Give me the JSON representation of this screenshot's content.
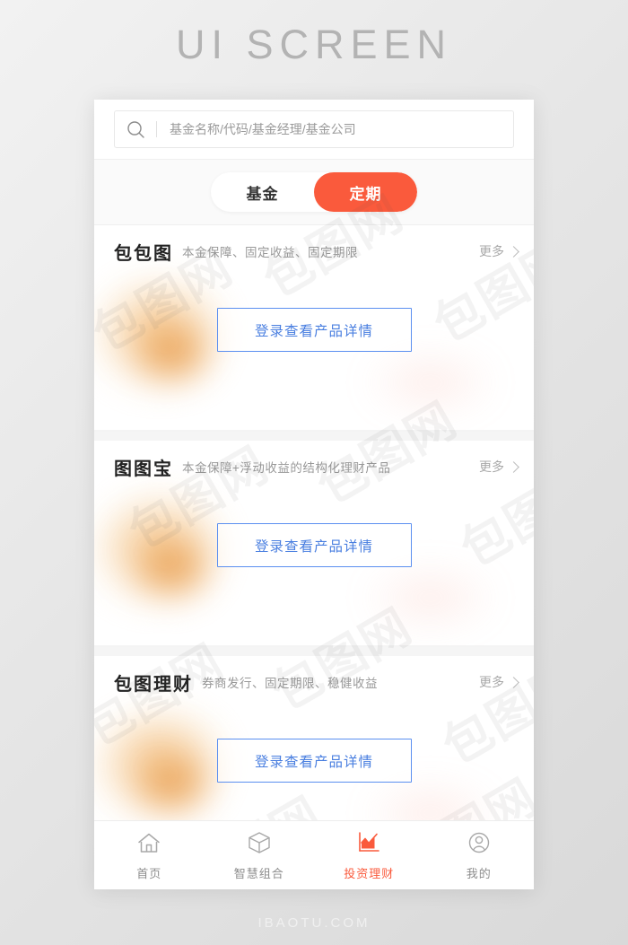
{
  "page": {
    "title": "UI SCREEN",
    "footer": "IBAOTU.COM",
    "watermark": "包图网"
  },
  "colors": {
    "accent": "#fa5a3c",
    "cta_blue": "#4a7fe0",
    "card_bg": "#ffffff",
    "page_bg": "#e8e8e8",
    "muted_text": "#999999"
  },
  "search": {
    "icon": "search-icon",
    "value": "",
    "placeholder": "基金名称/代码/基金经理/基金公司"
  },
  "tabs": {
    "items": [
      {
        "label": "基金",
        "active": false
      },
      {
        "label": "定期",
        "active": true
      }
    ]
  },
  "cards": [
    {
      "title": "包包图",
      "subtitle": "本金保障、固定收益、固定期限",
      "more_label": "更多",
      "cta_label": "登录查看产品详情"
    },
    {
      "title": "图图宝",
      "subtitle": "本金保障+浮动收益的结构化理财产品",
      "more_label": "更多",
      "cta_label": "登录查看产品详情"
    },
    {
      "title": "包图理财",
      "subtitle": "券商发行、固定期限、稳健收益",
      "more_label": "更多",
      "cta_label": "登录查看产品详情"
    }
  ],
  "tabbar": {
    "items": [
      {
        "label": "首页",
        "icon": "home-icon",
        "active": false
      },
      {
        "label": "智慧组合",
        "icon": "cube-icon",
        "active": false
      },
      {
        "label": "投资理财",
        "icon": "chart-icon",
        "active": true
      },
      {
        "label": "我的",
        "icon": "user-icon",
        "active": false
      }
    ]
  }
}
